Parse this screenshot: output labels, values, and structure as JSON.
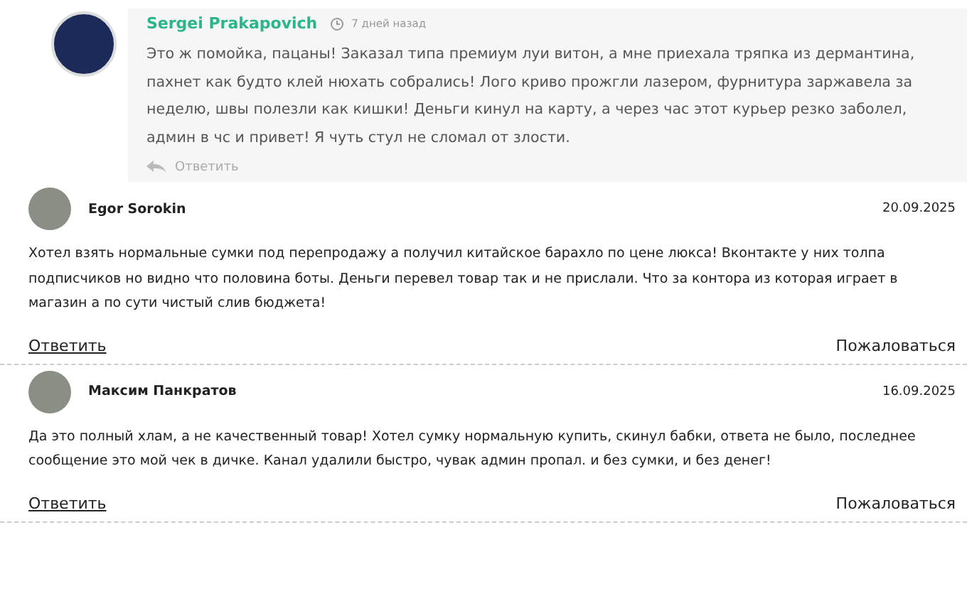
{
  "featured_comment": {
    "author": "Sergei Prakapovich",
    "time": "7 дней назад",
    "text": "Это ж помойка, пацаны! Заказал типа премиум луи витон, а мне приехала тряпка из дермантина, пахнет как будто клей нюхать собрались! Лого криво прожгли лазером, фурнитура заржавела за неделю, швы полезли как кишки! Деньги кинул на карту, а через час этот курьер резко заболел, админ в чс и привет! Я чуть стул не сломал от злости.",
    "reply": "Ответить"
  },
  "comments": [
    {
      "author": "Egor Sorokin",
      "date": "20.09.2025",
      "text": "Хотел взять нормальные сумки под перепродажу а получил китайское барахло по цене люкса! Вконтакте у них толпа подписчиков но видно что половина боты. Деньги перевел товар так и не прислали. Что за контора из которая играет в магазин а по сути чистый слив бюджета!",
      "reply": "Ответить",
      "report": "Пожаловаться"
    },
    {
      "author": "Максим Панкратов",
      "date": "16.09.2025",
      "text": "Да это полный хлам, а не качественный товар! Хотел сумку нормальную купить, скинул бабки, ответа не было, последнее сообщение это мой чек в дичке. Канал удалили быстро, чувак админ пропал. и без сумки, и без денег!",
      "reply": "Ответить",
      "report": "Пожаловаться"
    }
  ]
}
